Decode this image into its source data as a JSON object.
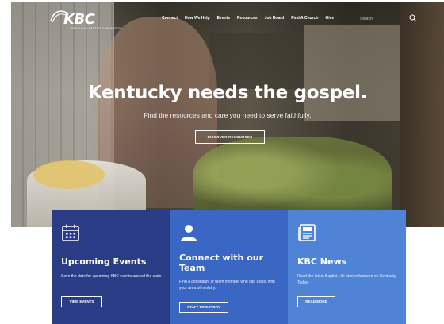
{
  "nav": {
    "logo_text": "KBC",
    "logo_subtitle": "KENTUCKY BAPTIST CONVENTION",
    "menu": [
      "Connect",
      "How We Help",
      "Events",
      "Resources",
      "Job Board",
      "Find A Church",
      "Give"
    ],
    "search_placeholder": "Search",
    "search_icon": "search-icon"
  },
  "hero": {
    "title": "Kentucky needs the gospel.",
    "subtitle": "Find the resources and care you need to serve faithfully.",
    "button_label": "DISCOVER RESOURCES"
  },
  "cards": [
    {
      "icon": "calendar-icon",
      "title": "Upcoming Events",
      "description": "Save the date for upcoming KBC events around the state",
      "button_label": "VIEW EVENTS",
      "color": "#2b3c86"
    },
    {
      "icon": "person-icon",
      "title": "Connect with our Team",
      "description": "Find a consultant or team member who can assist with your area of ministry.",
      "button_label": "STAFF DIRECTORY",
      "color": "#3a67c4"
    },
    {
      "icon": "newspaper-icon",
      "title": "KBC News",
      "description": "Read the latest Baptist Life stories featured on Kentucky Today",
      "button_label": "READ MORE",
      "color": "#4f83d6"
    }
  ]
}
